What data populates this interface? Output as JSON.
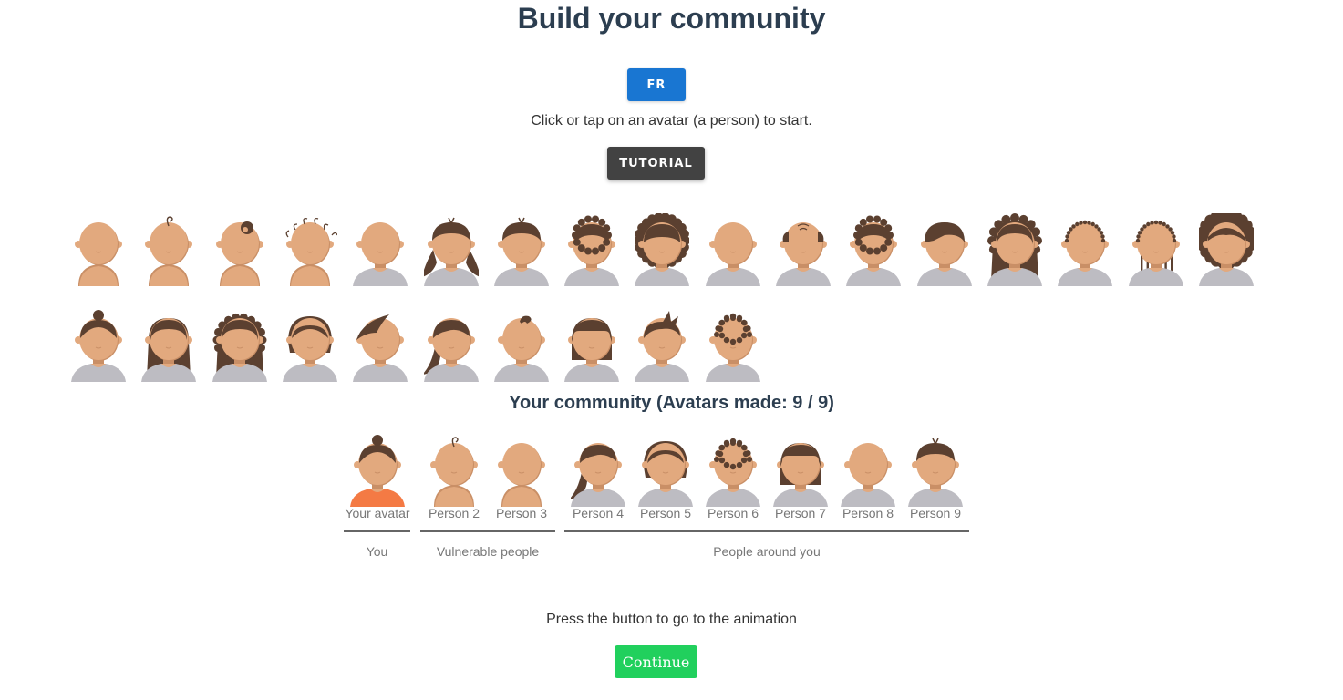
{
  "page": {
    "title": "Build your community"
  },
  "language_button": "FR",
  "intro_text": "Click or tap on an avatar (a person) to start.",
  "tutorial_button": "TUTORIAL",
  "colors": {
    "skin": "#e2a97e",
    "skin_shadow": "#c98f66",
    "hair": "#5b4030",
    "shirt": "#bdbcc2",
    "user_shirt": "#f47a44",
    "fr_button": "#1976d2",
    "continue_button": "#21d05d"
  },
  "avatar_gallery": [
    {
      "hair": "baby-bald",
      "shirt": "none"
    },
    {
      "hair": "baby-curl",
      "shirt": "none"
    },
    {
      "hair": "baby-bun",
      "shirt": "none"
    },
    {
      "hair": "baby-curls",
      "shirt": "none"
    },
    {
      "hair": "bald",
      "shirt": "gray"
    },
    {
      "hair": "pigtails",
      "shirt": "gray"
    },
    {
      "hair": "short-tuft",
      "shirt": "gray"
    },
    {
      "hair": "spiky-short",
      "shirt": "gray"
    },
    {
      "hair": "curly-big",
      "shirt": "gray"
    },
    {
      "hair": "bald",
      "shirt": "gray"
    },
    {
      "hair": "balding",
      "shirt": "gray"
    },
    {
      "hair": "spiky-short",
      "shirt": "gray"
    },
    {
      "hair": "side-part",
      "shirt": "gray"
    },
    {
      "hair": "long-wavy",
      "shirt": "gray"
    },
    {
      "hair": "buzz-dotted",
      "shirt": "gray"
    },
    {
      "hair": "braids",
      "shirt": "gray"
    },
    {
      "hair": "afro",
      "shirt": "gray"
    },
    {
      "hair": "top-bun",
      "shirt": "gray"
    },
    {
      "hair": "long-straight",
      "shirt": "gray"
    },
    {
      "hair": "long-curly",
      "shirt": "gray"
    },
    {
      "hair": "bob-round",
      "shirt": "gray"
    },
    {
      "hair": "swoop",
      "shirt": "gray"
    },
    {
      "hair": "side-ponytail",
      "shirt": "gray"
    },
    {
      "hair": "small-quiff",
      "shirt": "gray"
    },
    {
      "hair": "bangs-bob",
      "shirt": "gray"
    },
    {
      "hair": "messy-up",
      "shirt": "gray"
    },
    {
      "hair": "short-curly",
      "shirt": "gray"
    }
  ],
  "community": {
    "title": "Your community (Avatars made: 9 / 9)",
    "members": [
      {
        "label": "Your avatar",
        "hair": "top-bun",
        "shirt": "orange"
      },
      {
        "label": "Person 2",
        "hair": "baby-curl",
        "shirt": "none"
      },
      {
        "label": "Person 3",
        "hair": "baby-bald",
        "shirt": "none"
      },
      {
        "label": "Person 4",
        "hair": "side-ponytail",
        "shirt": "gray"
      },
      {
        "label": "Person 5",
        "hair": "bob-round",
        "shirt": "gray"
      },
      {
        "label": "Person 6",
        "hair": "short-curly",
        "shirt": "gray"
      },
      {
        "label": "Person 7",
        "hair": "bangs-bob",
        "shirt": "gray"
      },
      {
        "label": "Person 8",
        "hair": "bald",
        "shirt": "gray"
      },
      {
        "label": "Person 9",
        "hair": "short-tuft",
        "shirt": "gray"
      }
    ],
    "groups": [
      {
        "label": "You"
      },
      {
        "label": "Vulnerable people"
      },
      {
        "label": "People around you"
      }
    ]
  },
  "press_text": "Press the button to go to the animation",
  "continue_button": "Continue"
}
